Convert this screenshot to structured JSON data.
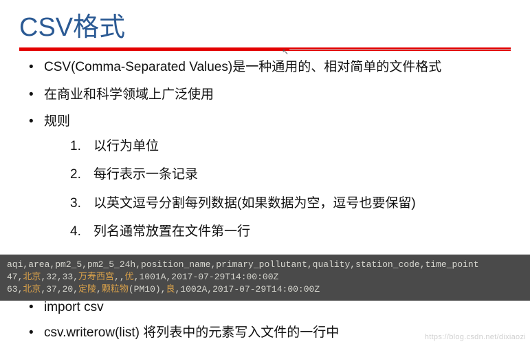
{
  "title": "CSV格式",
  "bullets": {
    "b1": "CSV(Comma-Separated Values)是一种通用的、相对简单的文件格式",
    "b2": "在商业和科学领域上广泛使用",
    "b3": "规则",
    "b4": "import csv",
    "b5": "csv.writerow(list) 将列表中的元素写入文件的一行中"
  },
  "rules": {
    "r1": "以行为单位",
    "r2": "每行表示一条记录",
    "r3": "以英文逗号分割每列数据(如果数据为空，逗号也要保留)",
    "r4": "列名通常放置在文件第一行"
  },
  "code": {
    "line1": "aqi,area,pm2_5,pm2_5_24h,position_name,primary_pollutant,quality,station_code,time_point",
    "line2_pre": "47,",
    "line2_hi1": "北京",
    "line2_mid": ",32,33,",
    "line2_hi2": "万寿西宫",
    "line2_mid2": ",,",
    "line2_hi3": "优",
    "line2_post": ",1001A,2017-07-29T14:00:00Z",
    "line3_pre": "63,",
    "line3_hi1": "北京",
    "line3_mid": ",37,20,",
    "line3_hi2": "定陵",
    "line3_mid2": ",",
    "line3_hi3": "颗粒物",
    "line3_mid3": "(PM10),",
    "line3_hi4": "良",
    "line3_post": ",1002A,2017-07-29T14:00:00Z"
  },
  "watermark": "https://blog.csdn.net/dixiaozi"
}
